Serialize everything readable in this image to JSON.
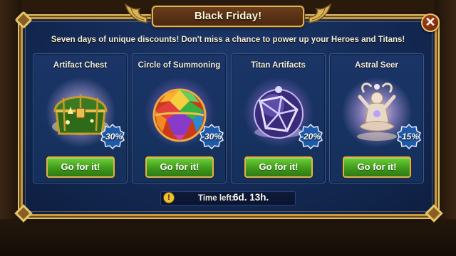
{
  "dialog": {
    "title": "Black Friday!",
    "subtitle": "Seven days of unique discounts! Don't miss a chance to power up your Heroes and Titans!",
    "close_label": "✕"
  },
  "offers": [
    {
      "title": "Artifact Chest",
      "discount": "-30%",
      "button": "Go for it!",
      "icon": "treasure-chest-icon"
    },
    {
      "title": "Circle of Summoning",
      "discount": "-30%",
      "button": "Go for it!",
      "icon": "gem-sphere-icon"
    },
    {
      "title": "Titan Artifacts",
      "discount": "-20%",
      "button": "Go for it!",
      "icon": "crystal-orb-icon"
    },
    {
      "title": "Astral Seer",
      "discount": "-15%",
      "button": "Go for it!",
      "icon": "astral-seer-icon"
    }
  ],
  "timer": {
    "icon_glyph": "!",
    "label": "Time left:",
    "value": "6d. 13h."
  },
  "colors": {
    "frame_gold": "#c89a3c",
    "panel_blue": "#142a55",
    "button_green": "#3f9a1c",
    "badge_blue": "#1f5aa8"
  }
}
